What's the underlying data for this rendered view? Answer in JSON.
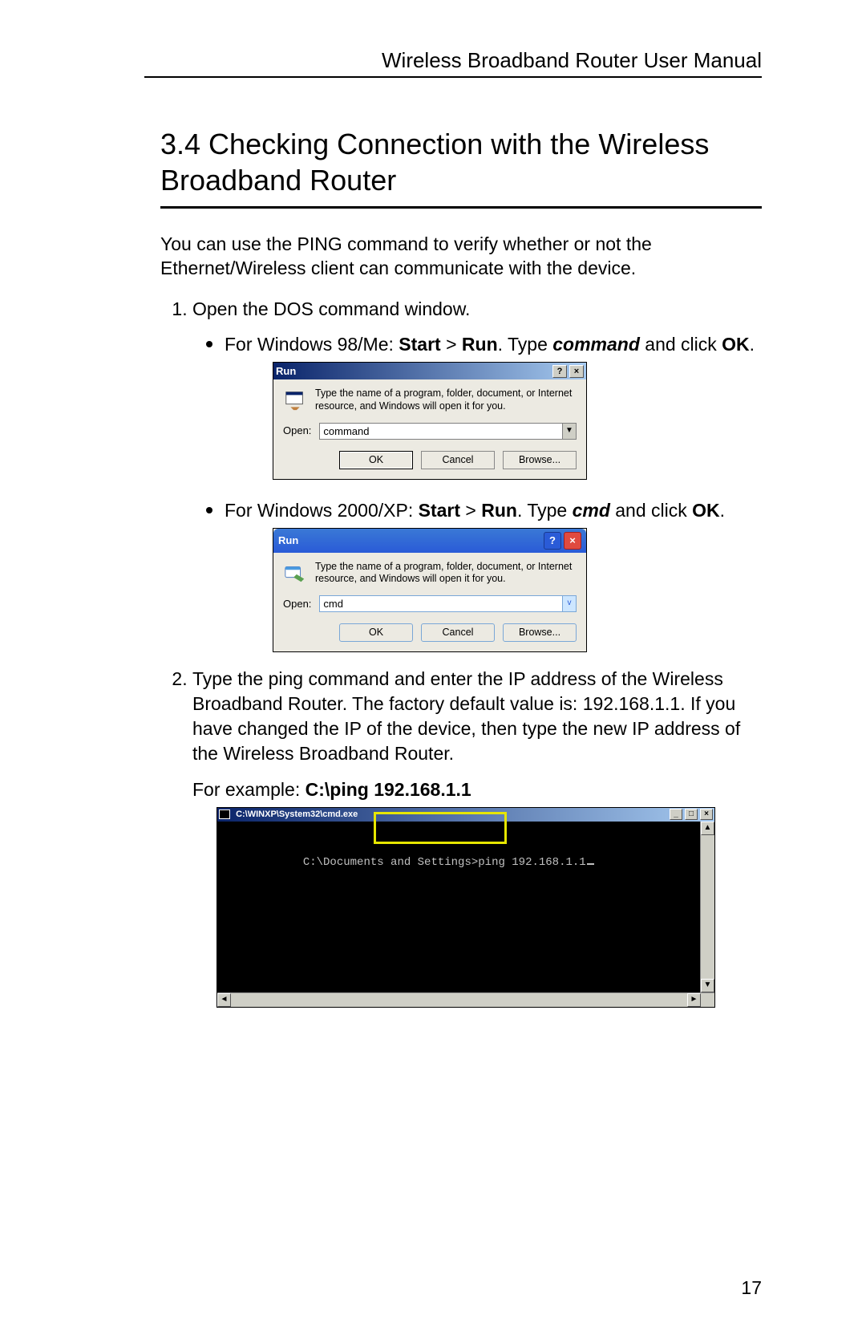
{
  "header": {
    "doc_title": "Wireless Broadband Router User Manual"
  },
  "section": {
    "number_title": "3.4 Checking Connection with the Wireless Broadband Router"
  },
  "intro": "You can use the PING command to verify whether or not the Ethernet/Wireless client can communicate with the device.",
  "step1": {
    "text": "Open the DOS command window.",
    "bullet1": {
      "prefix": "For Windows 98/Me: ",
      "b1": "Start",
      "gt": " > ",
      "b2": "Run",
      "mid": ". Type ",
      "cmd": "command",
      "mid2": " and click ",
      "b3": "OK",
      "end": "."
    },
    "bullet2": {
      "prefix": "For Windows 2000/XP: ",
      "b1": "Start",
      "gt": " > ",
      "b2": "Run",
      "mid": ". Type ",
      "cmd": "cmd",
      "mid2": " and click ",
      "b3": "OK",
      "end": "."
    }
  },
  "dialog98": {
    "title": "Run",
    "help": "?",
    "close": "×",
    "desc": "Type the name of a program, folder, document, or Internet resource, and Windows will open it for you.",
    "open_label": "Open:",
    "input_value": "command",
    "ok": "OK",
    "cancel": "Cancel",
    "browse": "Browse..."
  },
  "dialogxp": {
    "title": "Run",
    "help": "?",
    "close": "×",
    "desc": "Type the name of a program, folder, document, or Internet resource, and Windows will open it for you.",
    "open_label": "Open:",
    "input_value": "cmd",
    "ok": "OK",
    "cancel": "Cancel",
    "browse": "Browse..."
  },
  "step2": {
    "text": "Type the ping command and enter the IP address of the Wireless Broadband Router. The factory default value is: 192.168.1.1. If you have changed the IP of the device, then type the new IP address of the Wireless Broadband Router.",
    "example_prefix": "For example: ",
    "example_cmd": "C:\\ping 192.168.1.1"
  },
  "cmd": {
    "title": "C:\\WINXP\\System32\\cmd.exe",
    "min": "_",
    "max": "□",
    "close": "×",
    "prompt": "C:\\Documents and Settings>",
    "typed": "ping 192.168.1.1",
    "up": "▲",
    "down": "▼",
    "left": "◄",
    "right": "►"
  },
  "page_number": "17"
}
